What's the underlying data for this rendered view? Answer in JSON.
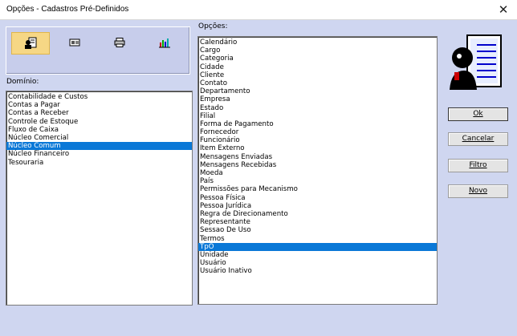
{
  "window": {
    "title": "Opções - Cadastros Pré-Definidos",
    "close_glyph": "✕"
  },
  "toolbar": {
    "buttons": [
      {
        "icon": "person-card-icon",
        "active": true
      },
      {
        "icon": "id-card-icon",
        "active": false
      },
      {
        "icon": "printer-icon",
        "active": false
      },
      {
        "icon": "chart-icon",
        "active": false
      }
    ]
  },
  "dominio": {
    "label": "Domínio:",
    "items": [
      "Contabilidade e Custos",
      "Contas a Pagar",
      "Contas a Receber",
      "Controle de Estoque",
      "Fluxo de Caixa",
      "Núcleo Comercial",
      "Núcleo Comum",
      "Núcleo Financeiro",
      "Tesouraria"
    ],
    "selected": "Núcleo Comum"
  },
  "opcoes": {
    "label": "Opções:",
    "items": [
      "Calendário",
      "Cargo",
      "Categoria",
      "Cidade",
      "Cliente",
      "Contato",
      "Departamento",
      "Empresa",
      "Estado",
      "Filial",
      "Forma de Pagamento",
      "Fornecedor",
      "Funcionário",
      "Item Externo",
      "Mensagens Enviadas",
      "Mensagens Recebidas",
      "Moeda",
      "País",
      "Permissões para Mecanismo",
      "Pessoa Física",
      "Pessoa Jurídica",
      "Regra de Direcionamento",
      "Representante",
      "Sessao De Uso",
      "Termos",
      "TpO",
      "Unidade",
      "Usuário",
      "Usuário Inativo"
    ],
    "selected": "TpO"
  },
  "buttons": {
    "ok": "Ok",
    "cancelar": "Cancelar",
    "filtro": "Filtro",
    "novo": "Novo"
  },
  "colors": {
    "background": "#cfd6f0",
    "selection": "#0a78d7",
    "active_tool": "#f6d785"
  }
}
